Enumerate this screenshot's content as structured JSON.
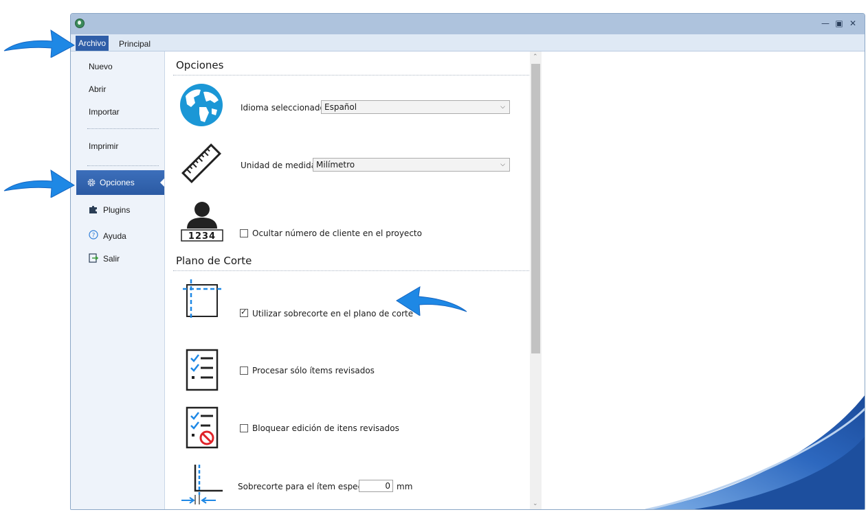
{
  "ribbon": {
    "tab_archivo": "Archivo",
    "tab_principal": "Principal"
  },
  "nav": {
    "nuevo": "Nuevo",
    "abrir": "Abrir",
    "importar": "Importar",
    "imprimir": "Imprimir",
    "opciones": "Opciones",
    "plugins": "Plugins",
    "ayuda": "Ayuda",
    "salir": "Salir"
  },
  "sections": {
    "opciones_title": "Opciones",
    "plano_title": "Plano de Corte"
  },
  "options": {
    "idioma_label": "Idioma seleccionado:",
    "idioma_value": "Español",
    "unidad_label": "Unidad de medida:",
    "unidad_value": "Milímetro",
    "ocultar_label": "Ocultar número de cliente en el proyecto",
    "ocultar_checked": false,
    "cliente_badge": "1234",
    "sobrecorte_label": "Utilizar sobrecorte en el plano de corte",
    "sobrecorte_checked": true,
    "procesar_label": "Procesar sólo ítems revisados",
    "procesar_checked": false,
    "bloquear_label": "Bloquear edición de itens revisados",
    "bloquear_checked": false,
    "especial_label": "Sobrecorte para el ítem especial",
    "especial_value": "0",
    "especial_unit": "mm"
  },
  "icons": {
    "app": "app-logo-icon",
    "gear": "gear-icon",
    "plugin": "puzzle-icon",
    "help": "help-circle-icon",
    "exit": "exit-icon",
    "globe": "globe-icon",
    "ruler": "ruler-icon",
    "client": "user-badge-icon",
    "trim": "trim-corner-icon",
    "checklist": "checklist-icon",
    "checklist_block": "checklist-blocked-icon",
    "special_trim": "special-trim-icon"
  },
  "colors": {
    "accent": "#2f5ea8",
    "arrow": "#1e88e5",
    "titlebar": "#aec3dd"
  }
}
